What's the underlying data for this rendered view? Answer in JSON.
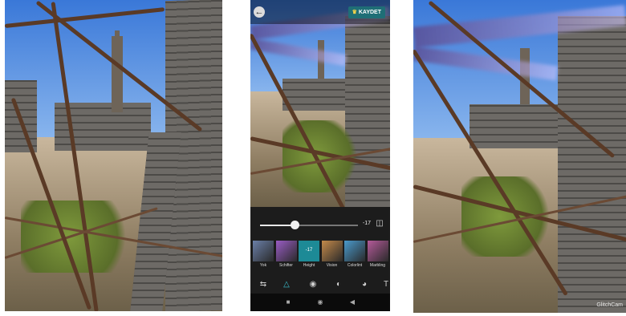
{
  "editor": {
    "save_label": "KAYDET",
    "slider_value": "-17",
    "slider_fraction": 0.35,
    "tools": [
      {
        "label": "Yok",
        "color": "#6a7fa8"
      },
      {
        "label": "Schifter",
        "color": "#9a5cc4"
      },
      {
        "label": "Height",
        "color": "#1d8a96",
        "value": "-17",
        "active": true
      },
      {
        "label": "Vision",
        "color": "#c48a4a"
      },
      {
        "label": "Colorlint",
        "color": "#4a9acc"
      },
      {
        "label": "Marbling",
        "color": "#b45a9a"
      }
    ],
    "tabs": [
      "adjust-icon",
      "effects-icon",
      "filters-icon",
      "color-icon",
      "overlay-icon",
      "text-icon"
    ],
    "nav": [
      "recents-icon",
      "home-icon",
      "back-nav-icon"
    ]
  },
  "watermark": "GlitchCam",
  "colors": {
    "accent": "#1d8a96",
    "save": "#1f6e76"
  }
}
